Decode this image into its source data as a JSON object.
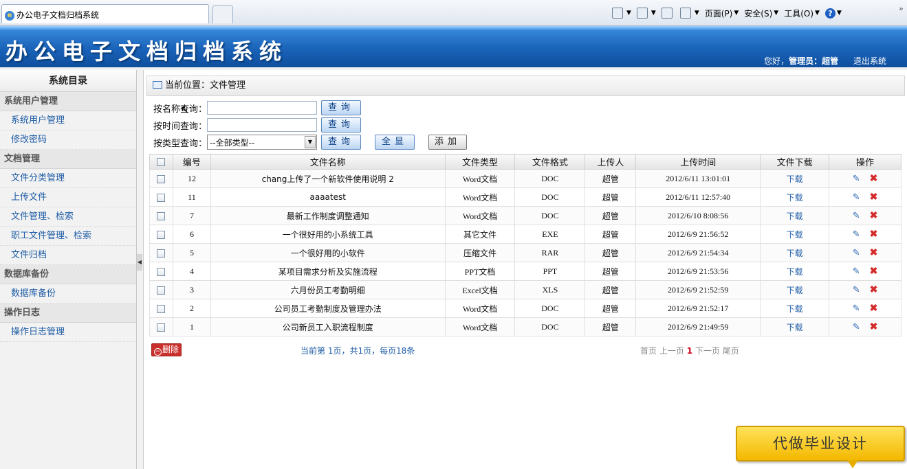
{
  "browser": {
    "tab_title": "办公电子文档归档系统",
    "commands": {
      "page": "页面(P)",
      "safety": "安全(S)",
      "tools": "工具(O)"
    }
  },
  "header": {
    "title": "办公电子文档归档系统",
    "greeting": "您好，",
    "role": "管理员：",
    "username": "超管",
    "logout": "退出系统"
  },
  "sidebar": {
    "title": "系统目录",
    "sections": [
      {
        "title": "系统用户管理",
        "items": [
          "系统用户管理",
          "修改密码"
        ]
      },
      {
        "title": "文档管理",
        "items": [
          "文件分类管理",
          "上传文件",
          "文件管理、检索",
          "职工文件管理、检索",
          "文件归档"
        ]
      },
      {
        "title": "数据库备份",
        "items": [
          "数据库备份"
        ]
      },
      {
        "title": "操作日志",
        "items": [
          "操作日志管理"
        ]
      }
    ]
  },
  "breadcrumb": {
    "label": "当前位置：",
    "value": "文件管理"
  },
  "query": {
    "by_name_label": "按名称查询：",
    "by_time_label": "按时间查询：",
    "by_type_label": "按类型查询：",
    "name_value": "",
    "time_value": "",
    "type_selected": "--全部类型--",
    "query_button": "查询",
    "show_all_button": "全显",
    "add_button": "添加"
  },
  "table": {
    "columns": [
      "编号",
      "文件名称",
      "文件类型",
      "文件格式",
      "上传人",
      "上传时间",
      "文件下载",
      "操作"
    ],
    "rows": [
      {
        "id": "12",
        "name": "chang上传了一个新软件使用说明 2",
        "type": "Word文档",
        "format": "DOC",
        "uploader": "超管",
        "time": "2012/6/11 13:01:01",
        "download": "下载"
      },
      {
        "id": "11",
        "name": "aaaatest",
        "type": "Word文档",
        "format": "DOC",
        "uploader": "超管",
        "time": "2012/6/11 12:57:40",
        "download": "下载"
      },
      {
        "id": "7",
        "name": "最新工作制度调整通知",
        "type": "Word文档",
        "format": "DOC",
        "uploader": "超管",
        "time": "2012/6/10 8:08:56",
        "download": "下载"
      },
      {
        "id": "6",
        "name": "一个很好用的小系统工具",
        "type": "其它文件",
        "format": "EXE",
        "uploader": "超管",
        "time": "2012/6/9 21:56:52",
        "download": "下载"
      },
      {
        "id": "5",
        "name": "一个很好用的小软件",
        "type": "压缩文件",
        "format": "RAR",
        "uploader": "超管",
        "time": "2012/6/9 21:54:34",
        "download": "下载"
      },
      {
        "id": "4",
        "name": "某项目需求分析及实施流程",
        "type": "PPT文档",
        "format": "PPT",
        "uploader": "超管",
        "time": "2012/6/9 21:53:56",
        "download": "下载"
      },
      {
        "id": "3",
        "name": "六月份员工考勤明细",
        "type": "Excel文档",
        "format": "XLS",
        "uploader": "超管",
        "time": "2012/6/9 21:52:59",
        "download": "下载"
      },
      {
        "id": "2",
        "name": "公司员工考勤制度及管理办法",
        "type": "Word文档",
        "format": "DOC",
        "uploader": "超管",
        "time": "2012/6/9 21:52:17",
        "download": "下载"
      },
      {
        "id": "1",
        "name": "公司新员工入职流程制度",
        "type": "Word文档",
        "format": "DOC",
        "uploader": "超管",
        "time": "2012/6/9 21:49:59",
        "download": "下载"
      }
    ]
  },
  "footer": {
    "delete_button": "删除",
    "page_info": "当前第 1页，共1页，每页18条",
    "pager": {
      "first": "首页",
      "prev": "上一页",
      "current": "1",
      "next": "下一页",
      "last": "尾页"
    }
  },
  "badge": {
    "text": "代做毕业设计"
  },
  "colors": {
    "header_blue": "#1a63b9",
    "link_blue": "#1f5da6",
    "delete_red": "#c9302c",
    "badge_yellow": "#f3b800"
  }
}
